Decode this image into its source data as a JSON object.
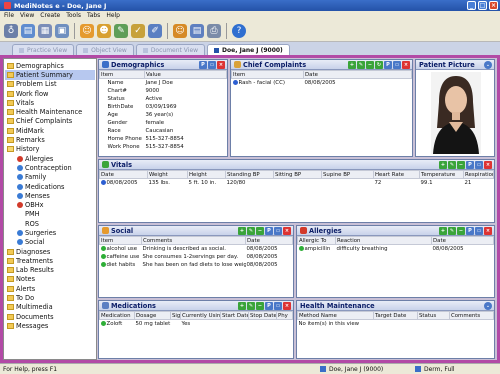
{
  "window": {
    "title": "MediNotes e - Doe, Jane J"
  },
  "menu": [
    "File",
    "View",
    "Create",
    "Tools",
    "Tabs",
    "Help"
  ],
  "tabs": [
    {
      "label": "Practice View",
      "active": false
    },
    {
      "label": "Object View",
      "active": false
    },
    {
      "label": "Document View",
      "active": false
    },
    {
      "label": "Doe, Jane J (9000)",
      "active": true
    }
  ],
  "sidebar": {
    "items": [
      {
        "label": "Demographics",
        "level": 0,
        "type": "folder"
      },
      {
        "label": "Patient Summary",
        "level": 0,
        "type": "folder",
        "selected": true
      },
      {
        "label": "Problem List",
        "level": 0,
        "type": "folder"
      },
      {
        "label": "Work flow",
        "level": 0,
        "type": "folder"
      },
      {
        "label": "Vitals",
        "level": 0,
        "type": "folder"
      },
      {
        "label": "Health Maintenance",
        "level": 0,
        "type": "folder"
      },
      {
        "label": "Chief Complaints",
        "level": 0,
        "type": "folder"
      },
      {
        "label": "MidMark",
        "level": 0,
        "type": "folder"
      },
      {
        "label": "Remarks",
        "level": 0,
        "type": "folder"
      },
      {
        "label": "History",
        "level": 0,
        "type": "open"
      },
      {
        "label": "Allergies",
        "level": 1,
        "color": "#d23a2a"
      },
      {
        "label": "Contraception",
        "level": 1,
        "color": "#3a7bd5"
      },
      {
        "label": "Family",
        "level": 1,
        "color": "#3a7bd5"
      },
      {
        "label": "Medications",
        "level": 1,
        "color": "#3a7bd5"
      },
      {
        "label": "Menses",
        "level": 1,
        "color": "#3a7bd5"
      },
      {
        "label": "OBHx",
        "level": 1,
        "color": "#d23a2a"
      },
      {
        "label": "PMH",
        "level": 1,
        "color": ""
      },
      {
        "label": "ROS",
        "level": 1,
        "color": ""
      },
      {
        "label": "Surgeries",
        "level": 1,
        "color": "#3a7bd5"
      },
      {
        "label": "Social",
        "level": 1,
        "color": "#3a7bd5"
      },
      {
        "label": "Diagnoses",
        "level": 0,
        "type": "folder"
      },
      {
        "label": "Treatments",
        "level": 0,
        "type": "folder"
      },
      {
        "label": "Lab Results",
        "level": 0,
        "type": "folder"
      },
      {
        "label": "Notes",
        "level": 0,
        "type": "folder"
      },
      {
        "label": "Alerts",
        "level": 0,
        "type": "folder"
      },
      {
        "label": "To Do",
        "level": 0,
        "type": "folder"
      },
      {
        "label": "Multimedia",
        "level": 0,
        "type": "folder"
      },
      {
        "label": "Documents",
        "level": 0,
        "type": "folder"
      },
      {
        "label": "Messages",
        "level": 0,
        "type": "folder"
      }
    ]
  },
  "demographics": {
    "title": "Demographics",
    "headers": [
      "Item",
      "Value"
    ],
    "rows": [
      [
        "Name",
        "Jane J Doe"
      ],
      [
        "Chart#",
        "9000"
      ],
      [
        "Status",
        "Active"
      ],
      [
        "BirthDate",
        "03/09/1969"
      ],
      [
        "Age",
        "36 year(s)"
      ],
      [
        "Gender",
        "female"
      ],
      [
        "Race",
        "Caucasian"
      ],
      [
        "Home Phone",
        "515-327-8854"
      ],
      [
        "Work Phone",
        "515-327-8854"
      ]
    ]
  },
  "complaints": {
    "title": "Chief Complaints",
    "headers": [
      "Item",
      "Date"
    ],
    "rows": [
      [
        "Rash - facial (CC)",
        "08/08/2005"
      ]
    ]
  },
  "picture": {
    "title": "Patient Picture"
  },
  "vitals": {
    "title": "Vitals",
    "headers": [
      "Date",
      "Weight",
      "Height",
      "Standing BP",
      "Sitting BP",
      "Supine BP",
      "Heart Rate",
      "Temperature",
      "Respiration"
    ],
    "rows": [
      [
        "08/08/2005",
        "135 lbs.",
        "5 ft. 10 in.",
        "120/80",
        "",
        "",
        "72",
        "99.1",
        "21"
      ]
    ]
  },
  "social": {
    "title": "Social",
    "headers": [
      "Item",
      "Comments",
      "Date"
    ],
    "rows": [
      [
        "alcohol use",
        "Drinking is described as social.",
        "08/08/2005"
      ],
      [
        "caffeine use",
        "She consumes 1-2servings per day.",
        "08/08/2005"
      ],
      [
        "diet habits",
        "She has been on fad diets to lose weight.",
        "08/08/2005"
      ]
    ]
  },
  "allergies": {
    "title": "Allergies",
    "headers": [
      "Allergic To",
      "Reaction",
      "Date"
    ],
    "rows": [
      [
        "ampicillin",
        "difficulty breathing",
        "08/08/2005"
      ]
    ]
  },
  "medications": {
    "title": "Medications",
    "headers": [
      "Medication",
      "Dosage",
      "Sig",
      "Currently Using",
      "Start Date",
      "Stop Date",
      "Phy"
    ],
    "rows": [
      [
        "Zoloft",
        "50 mg tablet",
        "",
        "Yes",
        "",
        "",
        ""
      ]
    ]
  },
  "health": {
    "title": "Health Maintenance",
    "headers": [
      "Method Name",
      "Target Date",
      "Status",
      "Comments"
    ],
    "empty": "No item(s) in this view"
  },
  "status": {
    "help": "For Help, press F1",
    "patient": "Doe, Jane J (9000)",
    "user": "Derm, Full"
  },
  "colors": {
    "frame": "#b24aa6",
    "header_text": "#0b1d66",
    "title_bar": "#2452a8"
  }
}
